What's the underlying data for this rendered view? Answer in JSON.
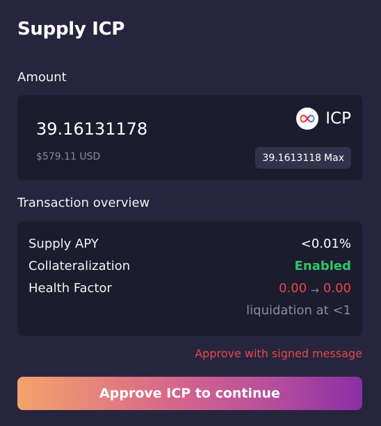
{
  "dialog": {
    "title": "Supply ICP"
  },
  "amount": {
    "label": "Amount",
    "value": "39.16131178",
    "usd": "$579.11 USD",
    "token": {
      "icon": "icp-infinity-icon",
      "symbol": "ICP"
    },
    "max": {
      "value": "39.1613118",
      "label": "Max"
    }
  },
  "overview": {
    "label": "Transaction overview",
    "rows": [
      {
        "label": "Supply APY",
        "value": "<0.01%"
      },
      {
        "label": "Collateralization",
        "value": "Enabled"
      },
      {
        "label": "Health Factor",
        "from": "0.00",
        "arrow": "→",
        "to": "0.00"
      }
    ],
    "liquidation_note": "liquidation at <1"
  },
  "approve_message": "Approve with signed message",
  "cta": {
    "label": "Approve ICP to continue"
  },
  "colors": {
    "background": "#27253d",
    "panel": "#1d1c2e",
    "success": "#2ec566",
    "danger": "#e5484d",
    "muted": "#8b8aa0"
  }
}
